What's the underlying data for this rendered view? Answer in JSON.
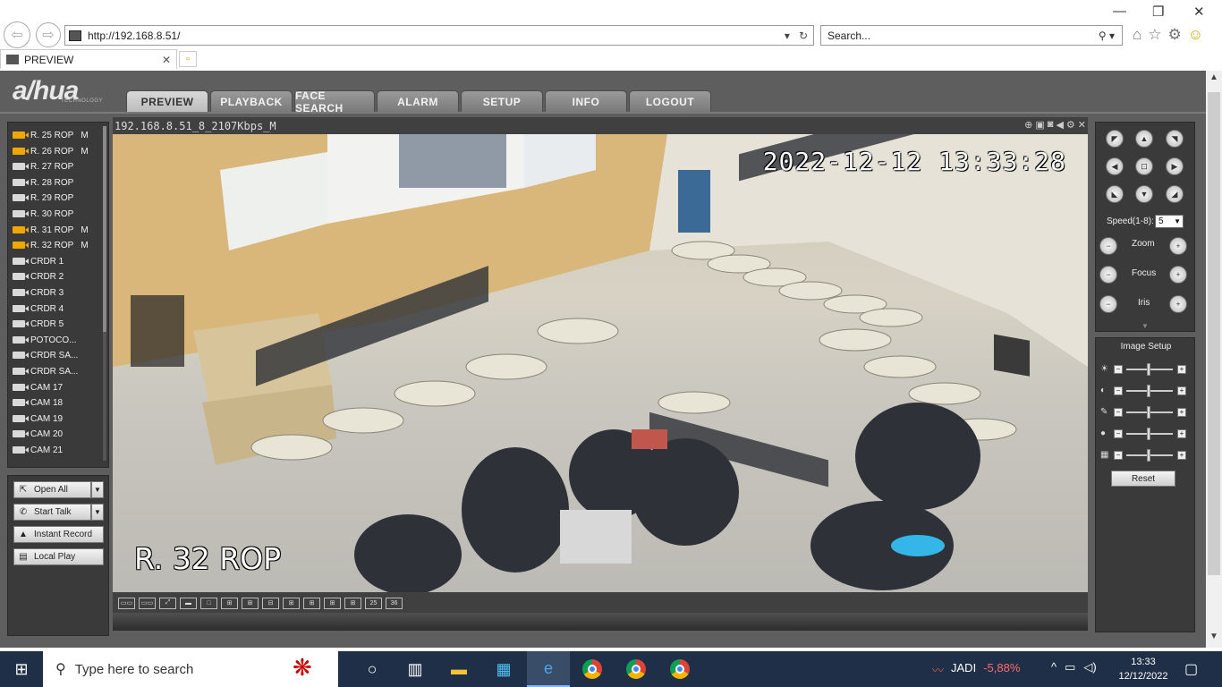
{
  "browser": {
    "url": "http://192.168.8.51/",
    "search_placeholder": "Search...",
    "tab_title": "PREVIEW",
    "controls": {
      "minimize": "—",
      "restore": "❐",
      "close": "✕"
    }
  },
  "app": {
    "logo": "a/hua",
    "logo_sub": "TECHNOLOGY",
    "menu": [
      "PREVIEW",
      "PLAYBACK",
      "FACE SEARCH",
      "ALARM",
      "SETUP",
      "INFO",
      "LOGOUT"
    ],
    "active_menu": "PREVIEW",
    "cameras": [
      {
        "name": "R. 25 ROP",
        "flag": "M",
        "recording": true
      },
      {
        "name": "R. 26 ROP",
        "flag": "M",
        "recording": true
      },
      {
        "name": "R. 27 ROP",
        "flag": "",
        "recording": false
      },
      {
        "name": "R. 28 ROP",
        "flag": "",
        "recording": false
      },
      {
        "name": "R. 29 ROP",
        "flag": "",
        "recording": false
      },
      {
        "name": "R. 30 ROP",
        "flag": "",
        "recording": false
      },
      {
        "name": "R. 31 ROP",
        "flag": "M",
        "recording": true
      },
      {
        "name": "R. 32 ROP",
        "flag": "M",
        "recording": true
      },
      {
        "name": "CRDR 1",
        "flag": "",
        "recording": false
      },
      {
        "name": "CRDR 2",
        "flag": "",
        "recording": false
      },
      {
        "name": "CRDR 3",
        "flag": "",
        "recording": false
      },
      {
        "name": "CRDR 4",
        "flag": "",
        "recording": false
      },
      {
        "name": "CRDR 5",
        "flag": "",
        "recording": false
      },
      {
        "name": "POTOCO...",
        "flag": "",
        "recording": false
      },
      {
        "name": "CRDR SA...",
        "flag": "",
        "recording": false
      },
      {
        "name": "CRDR SA...",
        "flag": "",
        "recording": false
      },
      {
        "name": "CAM 17",
        "flag": "",
        "recording": false
      },
      {
        "name": "CAM 18",
        "flag": "",
        "recording": false
      },
      {
        "name": "CAM 19",
        "flag": "",
        "recording": false
      },
      {
        "name": "CAM 20",
        "flag": "",
        "recording": false
      },
      {
        "name": "CAM 21",
        "flag": "",
        "recording": false
      }
    ],
    "controls": {
      "open_all": "Open All",
      "start_talk": "Start Talk",
      "instant_record": "Instant Record",
      "local_play": "Local Play"
    },
    "video": {
      "channel_info": "192.168.8.51_8_2107Kbps_M",
      "timestamp": "2022-12-12 13:33:28",
      "camera_label": "R. 32 ROP"
    },
    "layouts": [
      "▭▭",
      "▭▭",
      "⤢",
      "▬",
      "□",
      "⊞",
      "⊞",
      "⊟",
      "⊞",
      "⊞",
      "⊞",
      "⊞",
      "25",
      "36"
    ],
    "ptz": {
      "speed_label": "Speed(1-8):",
      "speed_value": "5",
      "zoom_label": "Zoom",
      "focus_label": "Focus",
      "iris_label": "Iris"
    },
    "image_setup": {
      "title": "Image Setup",
      "reset": "Reset"
    }
  },
  "taskbar": {
    "search_placeholder": "Type here to search",
    "stock_name": "JADI",
    "stock_change": "-5,88%",
    "time": "13:33",
    "date": "12/12/2022"
  }
}
